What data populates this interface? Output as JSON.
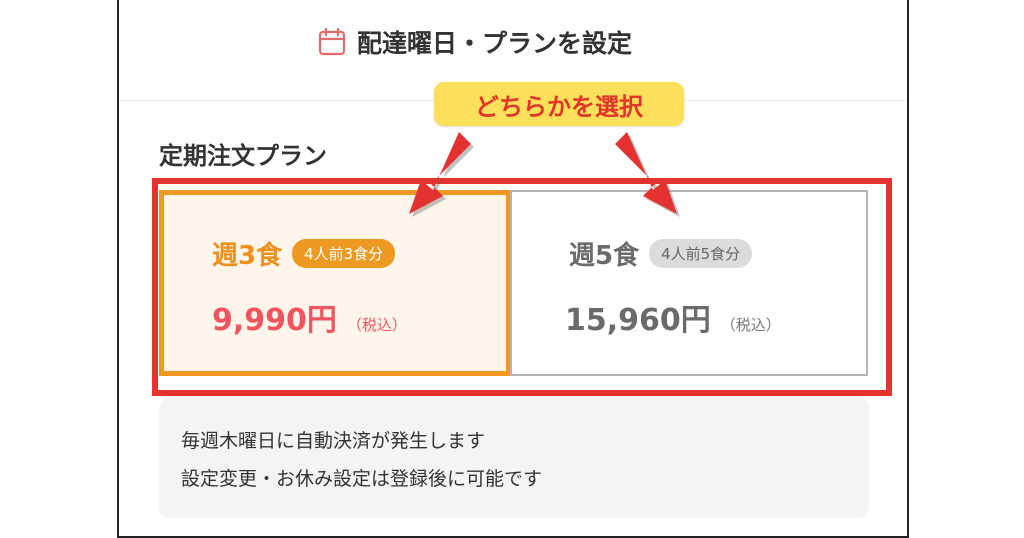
{
  "header": {
    "title": "配達曜日・プランを設定",
    "icon": "calendar-icon"
  },
  "callout": {
    "text": "どちらかを選択"
  },
  "plans": {
    "section_title": "定期注文プラン",
    "options": [
      {
        "name": "週3食",
        "badge": "4人前3食分",
        "price": "9,990円",
        "tax_note": "（税込）",
        "selected": true
      },
      {
        "name": "週5食",
        "badge": "4人前5食分",
        "price": "15,960円",
        "tax_note": "（税込）",
        "selected": false
      }
    ]
  },
  "info": {
    "lines": [
      "毎週木曜日に自動決済が発生します",
      "設定変更・お休み設定は登録後に可能です"
    ]
  },
  "colors": {
    "accent_orange": "#ee9a22",
    "price_pink": "#f2545f",
    "highlight_red": "#e3322f",
    "callout_yellow": "#fde05a"
  }
}
